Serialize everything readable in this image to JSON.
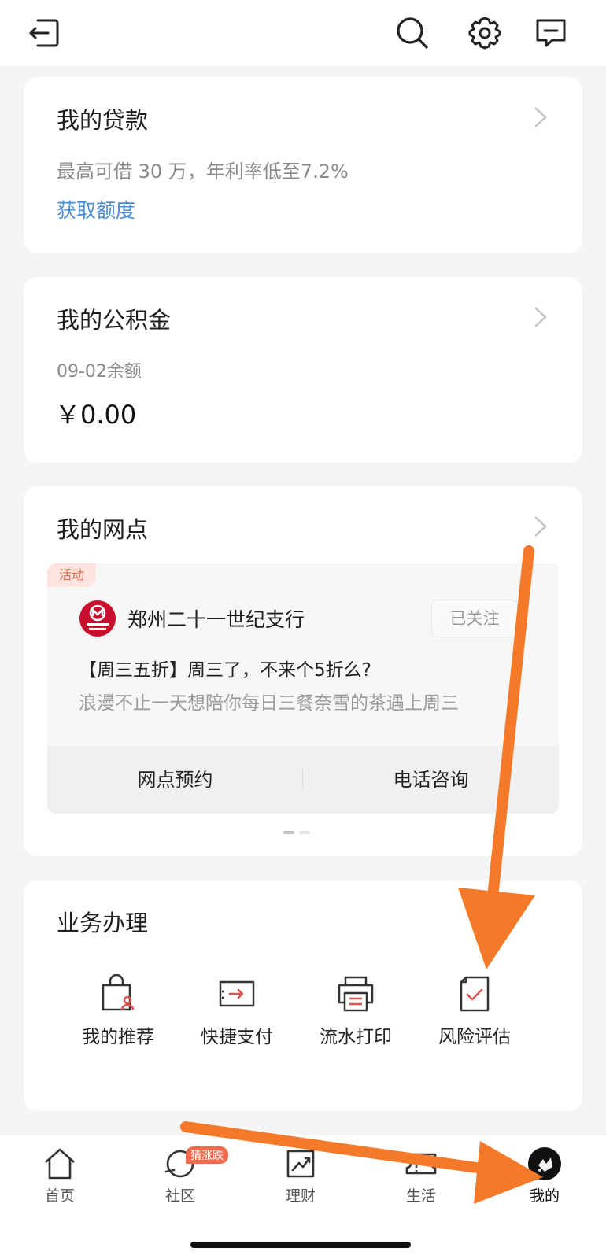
{
  "header": {
    "icons": [
      "exit-icon",
      "search-icon",
      "settings-gear-icon",
      "message-icon"
    ]
  },
  "loan": {
    "title": "我的贷款",
    "desc": "最高可借 30 万，年利率低至7.2%",
    "link": "获取额度"
  },
  "fund": {
    "title": "我的公积金",
    "date_label": "09-02余额",
    "amount": "￥0.00"
  },
  "branch": {
    "title": "我的网点",
    "tag": "活动",
    "name": "郑州二十一世纪支行",
    "follow": "已关注",
    "promo_title": "【周三五折】周三了，不来个5折么?",
    "promo_desc": "浪漫不止一天想陪你每日三餐奈雪的茶遇上周三",
    "actions": [
      "网点预约",
      "电话咨询"
    ]
  },
  "services": {
    "title": "业务办理",
    "items": [
      {
        "label": "我的推荐",
        "icon": "recommend-bag-icon"
      },
      {
        "label": "快捷支付",
        "icon": "quick-pay-icon"
      },
      {
        "label": "流水打印",
        "icon": "printer-icon"
      },
      {
        "label": "风险评估",
        "icon": "risk-assessment-icon"
      }
    ]
  },
  "tabs": [
    {
      "label": "首页",
      "icon": "home-icon"
    },
    {
      "label": "社区",
      "icon": "community-icon",
      "badge": "猜涨跌"
    },
    {
      "label": "理财",
      "icon": "finance-chart-icon"
    },
    {
      "label": "生活",
      "icon": "life-ticket-icon"
    },
    {
      "label": "我的",
      "icon": "avatar",
      "active": true
    }
  ],
  "colors": {
    "accent_red": "#c8102e",
    "link_blue": "#4a8fd6",
    "annotation_orange": "#f47a2a"
  }
}
